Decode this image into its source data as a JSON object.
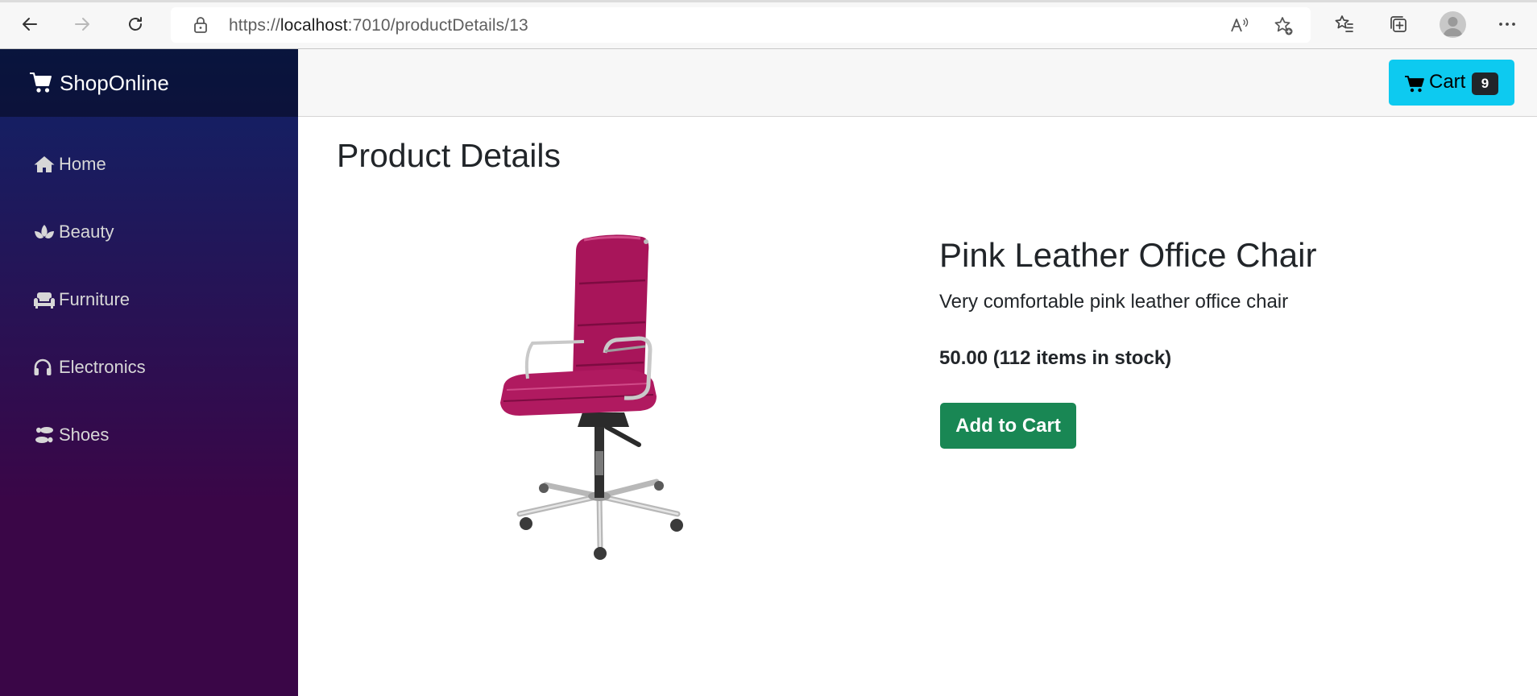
{
  "browser": {
    "url_prefix": "https://",
    "url_host": "localhost",
    "url_rest": ":7010/productDetails/13"
  },
  "sidebar": {
    "brand": "ShopOnline",
    "items": [
      {
        "label": "Home",
        "icon": "home-icon"
      },
      {
        "label": "Beauty",
        "icon": "spa-icon"
      },
      {
        "label": "Furniture",
        "icon": "couch-icon"
      },
      {
        "label": "Electronics",
        "icon": "headphones-icon"
      },
      {
        "label": "Shoes",
        "icon": "shoe-prints-icon"
      }
    ]
  },
  "header": {
    "cart_label": "Cart",
    "cart_count": "9"
  },
  "page": {
    "title": "Product Details"
  },
  "product": {
    "name": "Pink Leather Office Chair",
    "description": "Very comfortable pink leather office chair",
    "price_line": "50.00 (112 items in stock)",
    "add_label": "Add to Cart",
    "image": "pink-office-chair"
  },
  "colors": {
    "cart_button": "#0dcaf0",
    "add_button": "#198754",
    "sidebar_top": "#0f2367",
    "sidebar_bottom": "#3a0647",
    "chair": "#b0195f"
  }
}
